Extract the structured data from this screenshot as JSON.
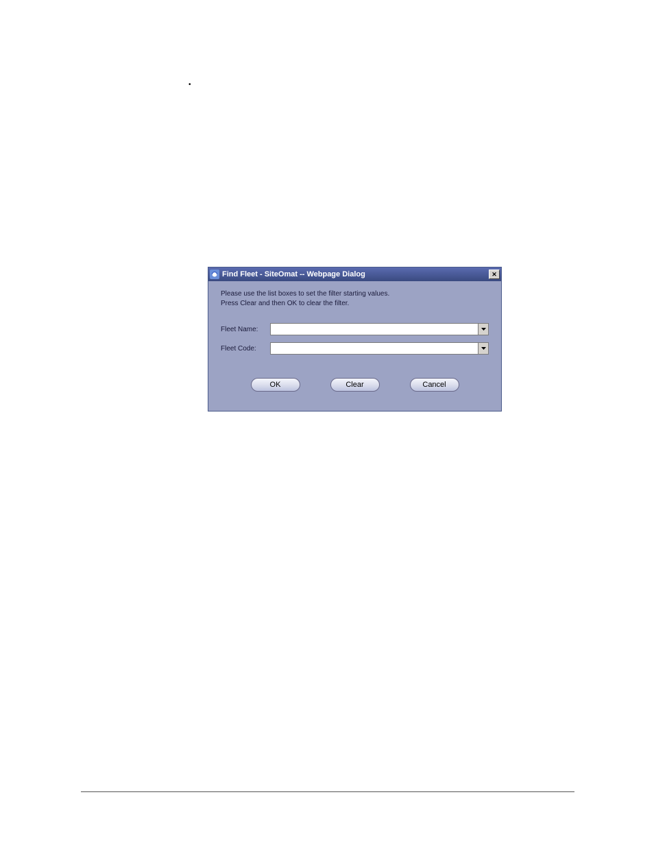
{
  "bullet_char": "•",
  "dialog": {
    "title": "Find Fleet - SiteOmat -- Webpage Dialog",
    "close_glyph": "✕",
    "instruction_line1": "Please use the list boxes to set the filter starting values.",
    "instruction_line2": "Press Clear and then OK to clear the filter.",
    "fields": {
      "fleet_name": {
        "label": "Fleet Name:",
        "value": ""
      },
      "fleet_code": {
        "label": "Fleet Code:",
        "value": ""
      }
    },
    "buttons": {
      "ok": "OK",
      "clear": "Clear",
      "cancel": "Cancel"
    }
  }
}
